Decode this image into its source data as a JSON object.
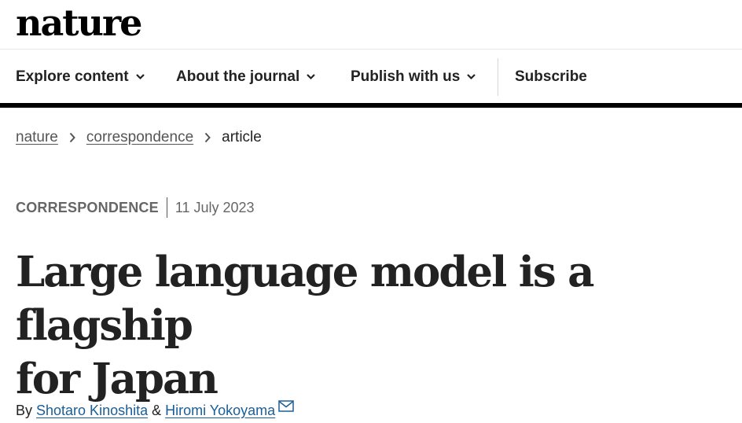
{
  "header": {
    "logo": "nature"
  },
  "nav": {
    "items": [
      {
        "label": "Explore content",
        "icon": "chevron-down-icon"
      },
      {
        "label": "About the journal",
        "icon": "chevron-down-icon"
      },
      {
        "label": "Publish with us",
        "icon": "chevron-down-icon"
      }
    ],
    "subscribe": "Subscribe"
  },
  "breadcrumb": {
    "items": [
      "nature",
      "correspondence"
    ],
    "current": "article"
  },
  "article": {
    "type": "CORRESPONDENCE",
    "date": "11 July 2023",
    "title_line1": "Large language model is a flagship",
    "title_line2": "for Japan",
    "byline_prefix": "By",
    "authors": [
      "Shotaro Kinoshita",
      "Hiromi Yokoyama"
    ],
    "author_separator": "&",
    "contact_icon": "envelope-icon"
  },
  "colors": {
    "text": "#222222",
    "link": "#1a5e97",
    "muted": "#666666",
    "nav_border": "#000000"
  }
}
